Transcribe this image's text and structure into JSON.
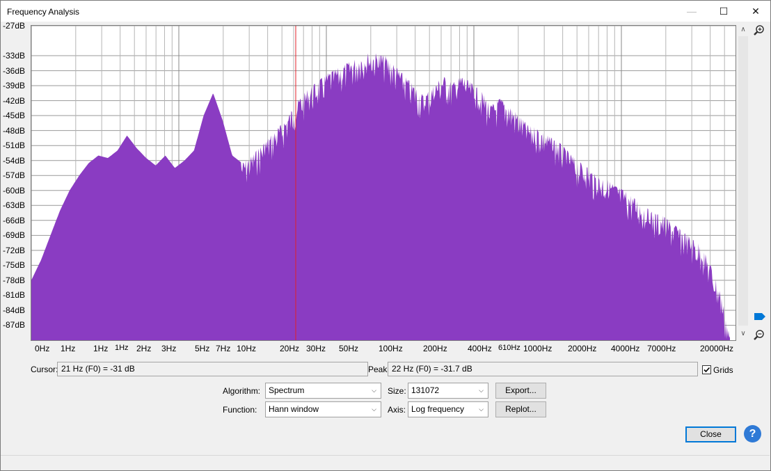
{
  "window": {
    "title": "Frequency Analysis",
    "minimize_glyph": "—",
    "maximize_glyph": "☐",
    "close_glyph": "✕"
  },
  "chart_data": {
    "type": "area",
    "x_scale": "log",
    "y_axis": {
      "unit": "dB",
      "tick_labels": [
        "-27dB",
        "-33dB",
        "-36dB",
        "-39dB",
        "-42dB",
        "-45dB",
        "-48dB",
        "-51dB",
        "-54dB",
        "-57dB",
        "-60dB",
        "-63dB",
        "-66dB",
        "-69dB",
        "-72dB",
        "-75dB",
        "-78dB",
        "-81dB",
        "-84dB",
        "-87dB"
      ],
      "range": [
        -90,
        -27
      ]
    },
    "x_axis": {
      "tick_labels": [
        "0Hz",
        "1Hz",
        "1Hz",
        "1Hz",
        "2Hz",
        "3Hz",
        "5Hz",
        "7Hz",
        "10Hz",
        "20Hz",
        "30Hz",
        "50Hz",
        "100Hz",
        "200Hz",
        "400Hz",
        "610Hz",
        "1000Hz",
        "2000Hz",
        "4000Hz",
        "7000Hz",
        "20000Hz"
      ]
    },
    "grid": true,
    "fill_color": "#8a3cc2",
    "cursor_line_color": "#e0202a",
    "spectrum_db": [
      -78,
      -74,
      -69,
      -64,
      -60,
      -57,
      -54.5,
      -53,
      -53.5,
      -52,
      -49,
      -51.5,
      -53.5,
      -55,
      -53,
      -55.5,
      -54,
      -52,
      -45,
      -40.5,
      -46,
      -53,
      -54.5,
      -53,
      -51,
      -49,
      -47,
      -44.5,
      -41.5,
      -39.5,
      -38,
      -36.5,
      -35.5,
      -34.5,
      -33.5,
      -32.5,
      -32.5,
      -33,
      -35,
      -37,
      -39,
      -41,
      -39,
      -37,
      -38.5,
      -37,
      -38.5,
      -40,
      -43,
      -41.5,
      -43,
      -45,
      -47,
      -47.5,
      -49,
      -50,
      -52,
      -54,
      -55,
      -57,
      -57.5,
      -59,
      -60,
      -61.5,
      -63,
      -64.5,
      -65,
      -66.5,
      -68,
      -69.5,
      -71,
      -75,
      -80,
      -89
    ],
    "cursor_db": -31,
    "cursor_freq_hz": 21
  },
  "readouts": {
    "cursor_label": "Cursor:",
    "cursor_value": "21 Hz (F0) = -31 dB",
    "peak_label": "Peak:",
    "peak_value": "22 Hz (F0) = -31.7 dB",
    "grids_label": "Grids",
    "grids_checked": true
  },
  "controls": {
    "algorithm_label": "Algorithm:",
    "algorithm_value": "Spectrum",
    "function_label": "Function:",
    "function_value": "Hann window",
    "size_label": "Size:",
    "size_value": "131072",
    "axis_label": "Axis:",
    "axis_value": "Log frequency",
    "export_label": "Export...",
    "replot_label": "Replot...",
    "close_label": "Close",
    "help_glyph": "?"
  }
}
